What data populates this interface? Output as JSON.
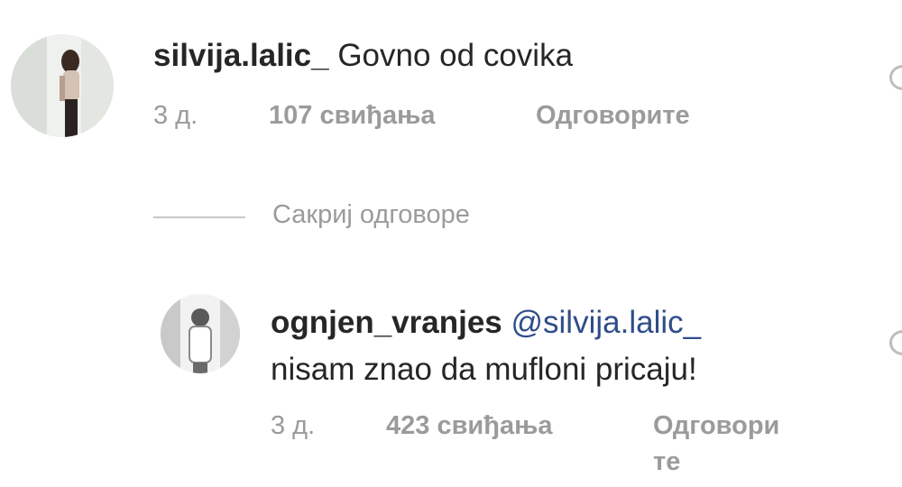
{
  "comments": [
    {
      "username": "silvija.lalic_",
      "text": "Govno od covika",
      "time": "3 д.",
      "likes": "107 свиђања",
      "reply_label": "Одговорите"
    }
  ],
  "hide_replies_label": "Сакриј одговоре",
  "reply": {
    "username": "ognjen_vranjes",
    "mention": "@silvija.lalic_",
    "text": "nisam znao da mufloni pricaju!",
    "time": "3 д.",
    "likes": "423 свиђања",
    "reply_label_line1": "Одговори",
    "reply_label_line2": "те"
  },
  "icons": [
    "avatar-silvija",
    "avatar-ognjen",
    "heart-icon"
  ]
}
